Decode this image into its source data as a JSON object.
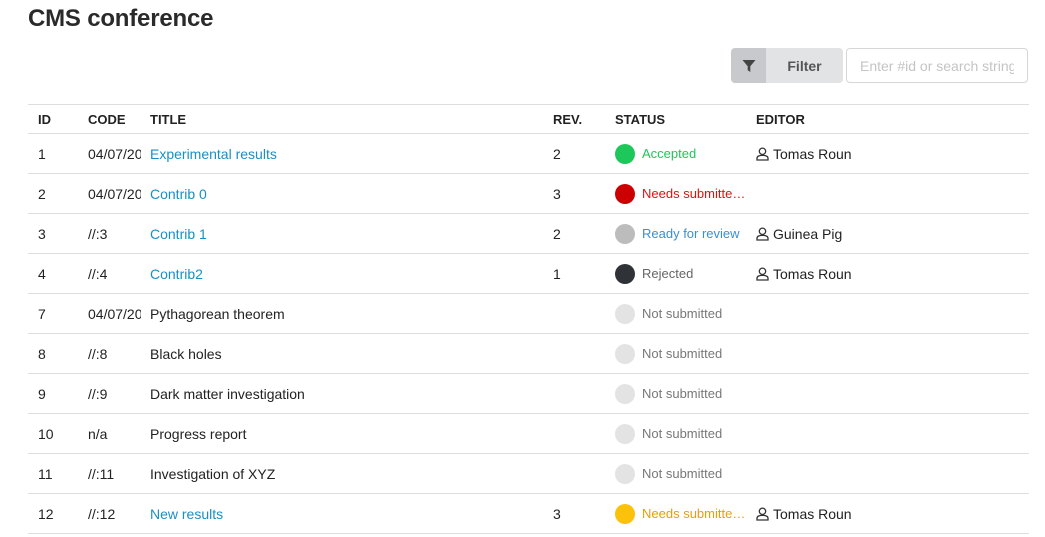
{
  "page": {
    "title": "CMS conference"
  },
  "toolbar": {
    "filter_label": "Filter",
    "filter_icon": "filter-funnel-icon",
    "search_placeholder": "Enter #id or search string",
    "search_value": ""
  },
  "table": {
    "columns": [
      "ID",
      "CODE",
      "TITLE",
      "REV.",
      "STATUS",
      "EDITOR"
    ],
    "rows": [
      {
        "id": "1",
        "code": "04/07/20",
        "title": "Experimental results",
        "title_link": true,
        "rev": "2",
        "status": "Accepted",
        "status_color": "#1ec75a",
        "status_text_color": "#1ec75a",
        "editor": "Tomas Roun"
      },
      {
        "id": "2",
        "code": "04/07/20",
        "title": "Contrib 0",
        "title_link": true,
        "rev": "3",
        "status": "Needs submitter changes",
        "status_color": "#cc0000",
        "status_text_color": "#dd1111",
        "editor": ""
      },
      {
        "id": "3",
        "code": "//:3",
        "title": "Contrib 1",
        "title_link": true,
        "rev": "2",
        "status": "Ready for review",
        "status_color": "#bcbcbc",
        "status_text_color": "#3b8fd1",
        "editor": "Guinea Pig"
      },
      {
        "id": "4",
        "code": "//:4",
        "title": "Contrib2",
        "title_link": true,
        "rev": "1",
        "status": "Rejected",
        "status_color": "#2f3236",
        "status_text_color": "#666666",
        "editor": "Tomas Roun"
      },
      {
        "id": "7",
        "code": "04/07/20",
        "title": "Pythagorean theorem",
        "title_link": false,
        "rev": "",
        "status": "Not submitted",
        "status_color": "#e3e3e3",
        "status_text_color": "#777777",
        "editor": ""
      },
      {
        "id": "8",
        "code": "//:8",
        "title": "Black holes",
        "title_link": false,
        "rev": "",
        "status": "Not submitted",
        "status_color": "#e3e3e3",
        "status_text_color": "#777777",
        "editor": ""
      },
      {
        "id": "9",
        "code": "//:9",
        "title": "Dark matter investigation",
        "title_link": false,
        "rev": "",
        "status": "Not submitted",
        "status_color": "#e3e3e3",
        "status_text_color": "#777777",
        "editor": ""
      },
      {
        "id": "10",
        "code": "n/a",
        "title": "Progress report",
        "title_link": false,
        "rev": "",
        "status": "Not submitted",
        "status_color": "#e3e3e3",
        "status_text_color": "#777777",
        "editor": ""
      },
      {
        "id": "11",
        "code": "//:11",
        "title": "Investigation of XYZ",
        "title_link": false,
        "rev": "",
        "status": "Not submitted",
        "status_color": "#e3e3e3",
        "status_text_color": "#777777",
        "editor": ""
      },
      {
        "id": "12",
        "code": "//:12",
        "title": "New results",
        "title_link": true,
        "rev": "3",
        "status": "Needs submitter confirmation",
        "status_color": "#fcc10a",
        "status_text_color": "#e5a008",
        "editor": "Tomas Roun"
      }
    ]
  }
}
